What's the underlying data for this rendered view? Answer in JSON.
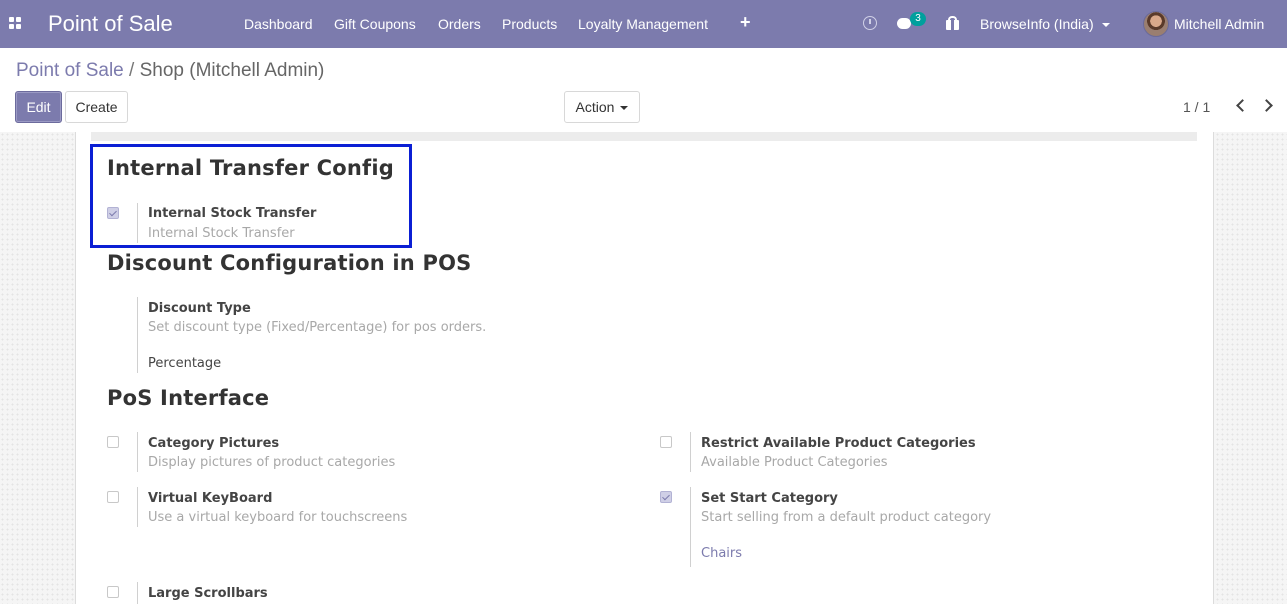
{
  "navbar": {
    "brand": "Point of Sale",
    "menu": [
      "Dashboard",
      "Gift Coupons",
      "Orders",
      "Products",
      "Loyalty Management"
    ],
    "icons": [
      "apps-grid-icon",
      "plus-icon",
      "clock-icon",
      "chat-icon",
      "gift-icon"
    ],
    "messages_badge": "3",
    "company": "BrowseInfo (India)",
    "user": "Mitchell Admin"
  },
  "breadcrumb": {
    "parent": "Point of Sale",
    "separator": "/",
    "current": "Shop (Mitchell Admin)"
  },
  "toolbar": {
    "edit_label": "Edit",
    "create_label": "Create",
    "action_label": "Action",
    "pager": "1 / 1"
  },
  "colors": {
    "brand": "#7c7bad",
    "highlight_border": "#0b1fd4",
    "badge": "#00a09d"
  },
  "sections": {
    "internal_transfer": {
      "title": "Internal Transfer Config",
      "stock_transfer": {
        "label": "Internal Stock Transfer",
        "description": "Internal Stock Transfer",
        "checked": true
      }
    },
    "discount": {
      "title": "Discount Configuration in POS",
      "discount_type": {
        "label": "Discount Type",
        "description": "Set discount type (Fixed/Percentage) for pos orders.",
        "value": "Percentage"
      }
    },
    "interface": {
      "title": "PoS Interface",
      "category_pictures": {
        "label": "Category Pictures",
        "description": "Display pictures of product categories",
        "checked": false
      },
      "virtual_keyboard": {
        "label": "Virtual KeyBoard",
        "description": "Use a virtual keyboard for touchscreens",
        "checked": false
      },
      "large_scrollbars": {
        "label": "Large Scrollbars",
        "checked": false
      },
      "restrict_categories": {
        "label": "Restrict Available Product Categories",
        "description": "Available Product Categories",
        "checked": false
      },
      "start_category": {
        "label": "Set Start Category",
        "description": "Start selling from a default product category",
        "value": "Chairs",
        "checked": true
      }
    }
  }
}
